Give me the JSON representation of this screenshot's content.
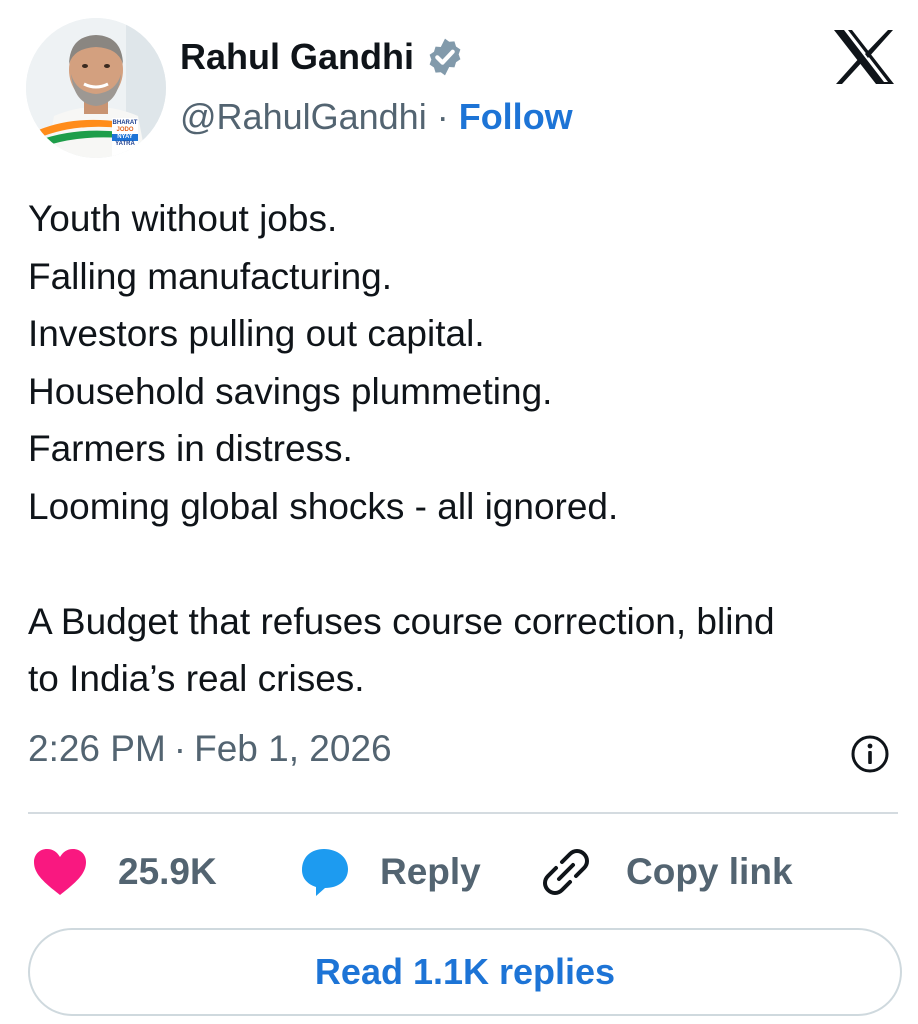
{
  "author": {
    "name": "Rahul Gandhi",
    "handle": "@RahulGandhi",
    "verified": true,
    "follow_label": "Follow",
    "separator": "·"
  },
  "brand": {
    "logo_icon": "x-logo-icon"
  },
  "avatar": {
    "icon": "profile-photo",
    "badge_text": [
      "BHARAT",
      "JODO",
      "NYAY",
      "YATRA"
    ]
  },
  "tweet": {
    "lines": [
      "Youth without jobs.",
      "Falling manufacturing.",
      "Investors pulling out capital.",
      "Household savings plummeting.",
      "Farmers in distress.",
      "Looming global shocks - all ignored.",
      "",
      "A Budget that refuses course correction, blind",
      "to India’s real crises."
    ]
  },
  "meta": {
    "time": "2:26 PM",
    "separator": "·",
    "date": "Feb 1, 2026",
    "info_icon": "info-icon"
  },
  "actions": {
    "like_count": "25.9K",
    "like_icon": "heart-icon",
    "like_color": "#f91880",
    "reply_label": "Reply",
    "reply_icon": "speech-bubble-icon",
    "reply_color": "#1d9bf0",
    "copy_label": "Copy link",
    "copy_icon": "link-icon"
  },
  "read_replies_label": "Read 1.1K replies",
  "colors": {
    "text_primary": "#0f1419",
    "text_secondary": "#536471",
    "accent": "#1d74d6",
    "divider": "#d4dbe0",
    "verified_badge": "#829aab"
  }
}
